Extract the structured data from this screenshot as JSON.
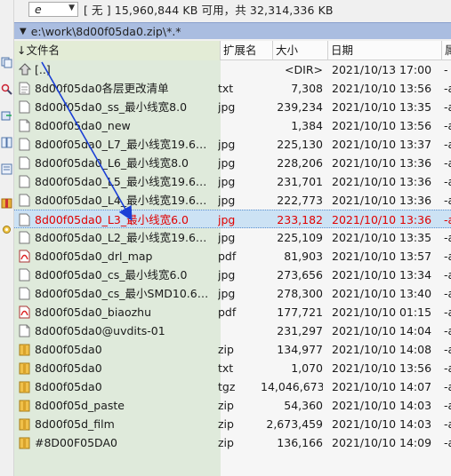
{
  "drive": {
    "letter": "e",
    "info": "[ 无 ]  15,960,844 KB 可用，共 32,314,336 KB"
  },
  "path": {
    "text": "e:\\work\\8d00f05da0.zip\\*.*"
  },
  "columns": {
    "name": "↓文件名",
    "ext": "扩展名",
    "size": "大小",
    "date": "日期",
    "attr": "属"
  },
  "files": [
    {
      "name": "[..]",
      "ext": "",
      "size": "<DIR>",
      "date": "2021/10/13 17:00",
      "attr": "-",
      "icon": "up-dir-icon"
    },
    {
      "name": "8d00f05da0各层更改清单",
      "ext": "txt",
      "size": "7,308",
      "date": "2021/10/10 13:56",
      "attr": "-a",
      "icon": "text-file-icon"
    },
    {
      "name": "8d00f05da0_ss_最小线宽8.0",
      "ext": "jpg",
      "size": "239,234",
      "date": "2021/10/10 13:35",
      "attr": "-a",
      "icon": "image-file-icon"
    },
    {
      "name": "8d00f05da0_new",
      "ext": "",
      "size": "1,384",
      "date": "2021/10/10 13:56",
      "attr": "-a",
      "icon": "generic-file-icon"
    },
    {
      "name": "8d00f05da0_L7_最小线宽19.6…",
      "ext": "jpg",
      "size": "225,130",
      "date": "2021/10/10 13:37",
      "attr": "-a",
      "icon": "image-file-icon"
    },
    {
      "name": "8d00f05da0_L6_最小线宽8.0",
      "ext": "jpg",
      "size": "228,206",
      "date": "2021/10/10 13:36",
      "attr": "-a",
      "icon": "image-file-icon"
    },
    {
      "name": "8d00f05da0_L5_最小线宽19.6…",
      "ext": "jpg",
      "size": "231,701",
      "date": "2021/10/10 13:36",
      "attr": "-a",
      "icon": "image-file-icon"
    },
    {
      "name": "8d00f05da0_L4_最小线宽19.6…",
      "ext": "jpg",
      "size": "222,773",
      "date": "2021/10/10 13:36",
      "attr": "-a",
      "icon": "image-file-icon"
    },
    {
      "name": "8d00f05da0_L3_最小线宽6.0",
      "ext": "jpg",
      "size": "233,182",
      "date": "2021/10/10 13:36",
      "attr": "-a",
      "icon": "image-file-icon",
      "selected": true
    },
    {
      "name": "8d00f05da0_L2_最小线宽19.6…",
      "ext": "jpg",
      "size": "225,109",
      "date": "2021/10/10 13:35",
      "attr": "-a",
      "icon": "image-file-icon"
    },
    {
      "name": "8d00f05da0_drl_map",
      "ext": "pdf",
      "size": "81,903",
      "date": "2021/10/10 13:57",
      "attr": "-a",
      "icon": "pdf-file-icon"
    },
    {
      "name": "8d00f05da0_cs_最小线宽6.0",
      "ext": "jpg",
      "size": "273,656",
      "date": "2021/10/10 13:34",
      "attr": "-a",
      "icon": "image-file-icon"
    },
    {
      "name": "8d00f05da0_cs_最小SMD10.6…",
      "ext": "jpg",
      "size": "278,300",
      "date": "2021/10/10 13:40",
      "attr": "-a",
      "icon": "image-file-icon"
    },
    {
      "name": "8d00f05da0_biaozhu",
      "ext": "pdf",
      "size": "177,721",
      "date": "2021/10/10 01:15",
      "attr": "-a",
      "icon": "pdf-file-icon"
    },
    {
      "name": "8d00f05da0@uvdits-01",
      "ext": "",
      "size": "231,297",
      "date": "2021/10/10 14:04",
      "attr": "-a",
      "icon": "generic-file-icon"
    },
    {
      "name": "8d00f05da0",
      "ext": "zip",
      "size": "134,977",
      "date": "2021/10/10 14:08",
      "attr": "-a",
      "icon": "archive-file-icon"
    },
    {
      "name": "8d00f05da0",
      "ext": "txt",
      "size": "1,070",
      "date": "2021/10/10 13:56",
      "attr": "-a",
      "icon": "archive-file-icon"
    },
    {
      "name": "8d00f05da0",
      "ext": "tgz",
      "size": "14,046,673",
      "date": "2021/10/10 14:07",
      "attr": "-a",
      "icon": "archive-file-icon"
    },
    {
      "name": "8d00f05d_paste",
      "ext": "zip",
      "size": "54,360",
      "date": "2021/10/10 14:03",
      "attr": "-a",
      "icon": "archive-file-icon"
    },
    {
      "name": "8d00f05d_film",
      "ext": "zip",
      "size": "2,673,459",
      "date": "2021/10/10 14:03",
      "attr": "-a",
      "icon": "archive-file-icon"
    },
    {
      "name": "#8D00F05DA0",
      "ext": "zip",
      "size": "136,166",
      "date": "2021/10/10 14:09",
      "attr": "-a",
      "icon": "archive-file-icon"
    }
  ],
  "colors": {
    "selected_text": "#e00000",
    "selected_bg": "#cce2f4",
    "path_bar": "#aabde0",
    "name_column_bg": "#dfeadb",
    "arrow": "#1a3fd6"
  }
}
